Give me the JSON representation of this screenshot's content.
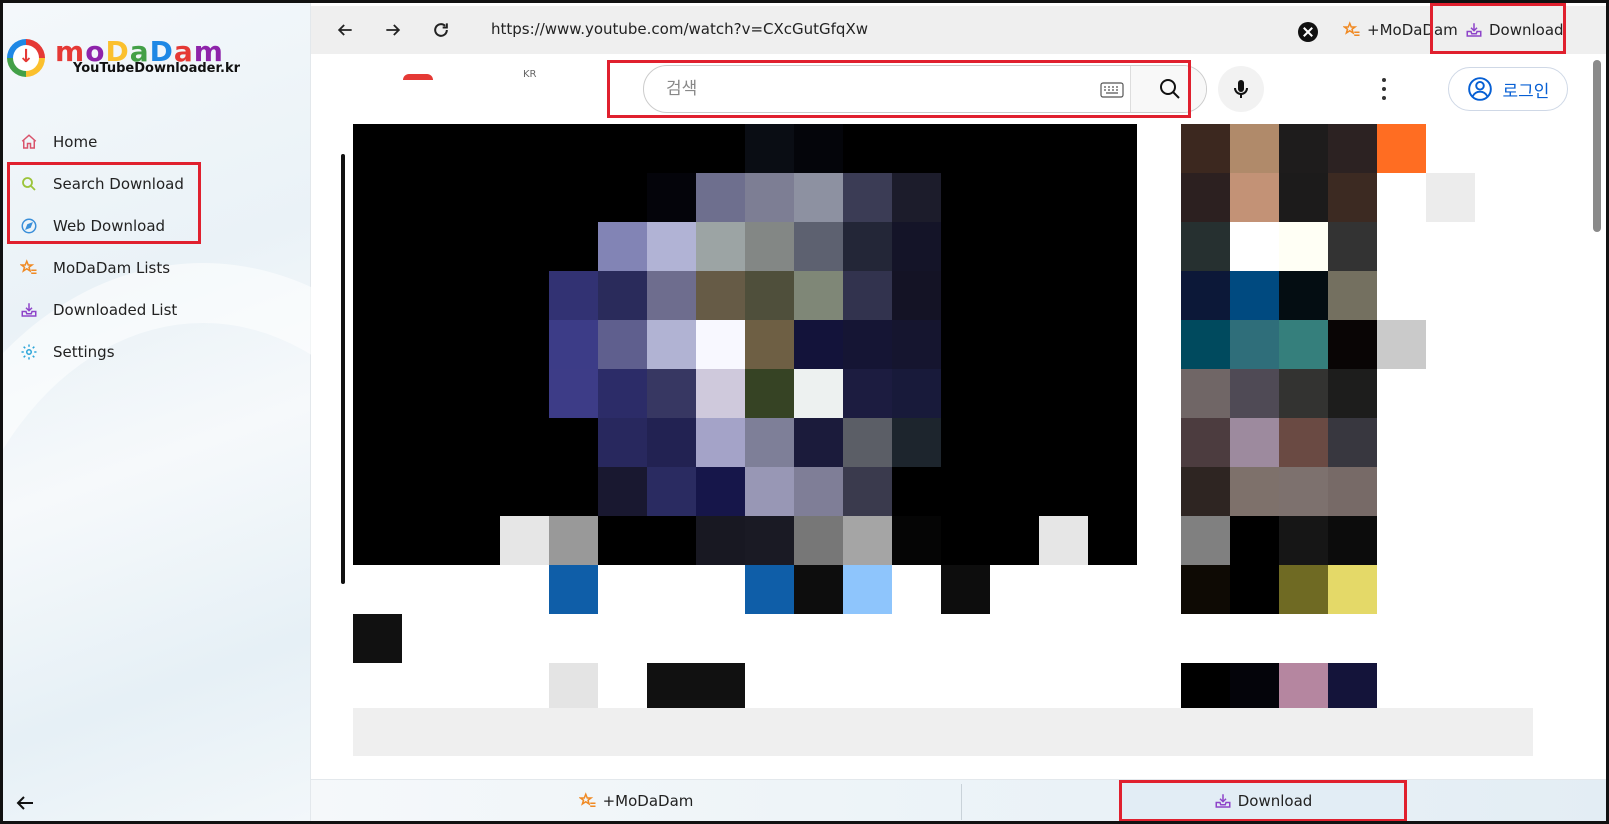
{
  "brand": {
    "logo_letters": [
      "m",
      "o",
      "D",
      "a",
      "D",
      "a",
      "m"
    ],
    "subtitle": "YouTubeDownloader.kr",
    "colors": {
      "red": "#e53935",
      "purple": "#8e24aa",
      "yellow": "#fbc02d",
      "green": "#43a047",
      "blue": "#1e88e5"
    }
  },
  "sidebar": {
    "items": [
      {
        "label": "Home",
        "icon": "home-icon",
        "color": "#d9536b"
      },
      {
        "label": "Search Download",
        "icon": "search-icon",
        "color": "#9bc43a"
      },
      {
        "label": "Web Download",
        "icon": "compass-icon",
        "color": "#3a8fd9"
      },
      {
        "label": "MoDaDam Lists",
        "icon": "star-list-icon",
        "color": "#f08a24"
      },
      {
        "label": "Downloaded List",
        "icon": "tray-download-icon",
        "color": "#8e44c9"
      },
      {
        "label": "Settings",
        "icon": "gear-icon",
        "color": "#2ba5d9"
      }
    ],
    "back_icon": "arrow-left-icon"
  },
  "browser": {
    "url": "https://www.youtube.com/watch?v=CXcGutGfqXw",
    "nav_icons": [
      "back-arrow-icon",
      "forward-arrow-icon",
      "reload-icon"
    ],
    "top_modadam_label": "+MoDaDam",
    "top_download_label": "Download"
  },
  "youtube": {
    "region": "KR",
    "search_placeholder": "검색",
    "login_label": "로그인"
  },
  "bottom_bar": {
    "modadam_label": "+MoDaDam",
    "download_label": "Download"
  },
  "accent": {
    "highlight": "#e0202e",
    "link_blue": "#065fd4"
  },
  "pixelated_video": {
    "cols": 16,
    "rows": [
      [
        "#000",
        "#000",
        "#000",
        "#000",
        "#000",
        "#000",
        "#000",
        "#000",
        "#0a0d14",
        "#04050a",
        "#000",
        "#000",
        "#000",
        "#000",
        "#000",
        "#000"
      ],
      [
        "#000",
        "#000",
        "#000",
        "#000",
        "#000",
        "#000",
        "#04040a",
        "#6e6f8e",
        "#7d7e94",
        "#8d91a1",
        "#3b3c55",
        "#1c1c2b",
        "#000",
        "#000",
        "#000",
        "#000"
      ],
      [
        "#000",
        "#000",
        "#000",
        "#000",
        "#000",
        "#8284b5",
        "#b1b3d5",
        "#9ca4a4",
        "#838785",
        "#5d6170",
        "#232637",
        "#141428",
        "#000",
        "#000",
        "#000",
        "#000"
      ],
      [
        "#000",
        "#000",
        "#000",
        "#000",
        "#323273",
        "#2a2b5b",
        "#6e6d8e",
        "#665b46",
        "#4f4f3b",
        "#7f8777",
        "#32334e",
        "#141325",
        "#000",
        "#000",
        "#000",
        "#000"
      ],
      [
        "#000",
        "#000",
        "#000",
        "#000",
        "#3c3c87",
        "#5f5f8e",
        "#b1b3d3",
        "#f8f8ff",
        "#6e5f44",
        "#13133a",
        "#151534",
        "#15152f",
        "#000",
        "#000",
        "#000",
        "#000"
      ],
      [
        "#000",
        "#000",
        "#000",
        "#000",
        "#3d3c87",
        "#2c2c68",
        "#373762",
        "#cfc9dc",
        "#364324",
        "#edf1f0",
        "#1c1c40",
        "#181a3a",
        "#000",
        "#000",
        "#000",
        "#000"
      ],
      [
        "#000",
        "#000",
        "#000",
        "#000",
        "#000",
        "#28285e",
        "#222252",
        "#a4a3c8",
        "#7e7f98",
        "#1b1b3b",
        "#5b5e66",
        "#1d252d",
        "#000",
        "#000",
        "#000",
        "#000"
      ],
      [
        "#000",
        "#000",
        "#000",
        "#000",
        "#000",
        "#191830",
        "#2a2b61",
        "#16164a",
        "#9897b5",
        "#7f7e97",
        "#3a3a4d",
        "#000",
        "#000",
        "#000",
        "#000",
        "#000"
      ],
      [
        "#000",
        "#000",
        "#000",
        "#e6e6e6",
        "#999",
        "#000",
        "#000",
        "#181822",
        "#1a1a24",
        "#777",
        "#a5a5a5",
        "#050505",
        "#000",
        "#000",
        "#e6e6e6",
        "#000"
      ],
      [
        "#fff",
        "#fff",
        "#fff",
        "#fff",
        "#0f5ea8",
        "#fff",
        "#fff",
        "#fff",
        "#0f5ea8",
        "#0d0d0d",
        "#8ec5fc",
        "#fff",
        "#0d0d0d",
        "#fff",
        "#fff",
        "#fff"
      ],
      [
        "#111",
        "#fff",
        "#fff",
        "#fff",
        "#fff",
        "#fff",
        "#fff",
        "#fff",
        "#fff",
        "#fff",
        "#fff",
        "#fff",
        "#fff",
        "#fff",
        "#fff",
        "#fff"
      ],
      [
        "#fff",
        "#fff",
        "#fff",
        "#fff",
        "#e4e4e4",
        "#fff",
        "#111",
        "#111",
        "#fff",
        "#fff",
        "#fff",
        "#fff",
        "#fff",
        "#fff",
        "#fff",
        "#fff"
      ],
      [
        "#fff",
        "#fff",
        "#fff",
        "#fff",
        "#fff",
        "#fff",
        "#fff",
        "#fff",
        "#fff",
        "#fff",
        "#fff",
        "#fff",
        "#fff",
        "#fff",
        "#fff",
        "#fff"
      ]
    ]
  },
  "pixelated_sidebar": {
    "cols": 6,
    "rows": [
      [
        "#3c281f",
        "#b08a6a",
        "#1e1c1c",
        "#2c2222",
        "#ff6d22",
        "#fff"
      ],
      [
        "#2c2020",
        "#c39276",
        "#1c1b1b",
        "#3c2a22",
        "#fff",
        "#ececec"
      ],
      [
        "#263030",
        "#fff",
        "#fffff5",
        "#333",
        "#fff",
        "#fff"
      ],
      [
        "#0c1838",
        "#004a80",
        "#040d12",
        "#747060",
        "#fff",
        "#fff"
      ],
      [
        "#004a5e",
        "#2f6e7a",
        "#357f7c",
        "#090505",
        "#cacaca",
        "#fff"
      ],
      [
        "#706666",
        "#4f4a55",
        "#333331",
        "#1d1d1c",
        "#fff",
        "#fff"
      ],
      [
        "#4c3c3f",
        "#9d8a9e",
        "#6a4a43",
        "#38373f",
        "#fff",
        "#fff"
      ],
      [
        "#2e2522",
        "#7e716b",
        "#7d716e",
        "#776a67",
        "#fff",
        "#fff"
      ],
      [
        "#808080",
        "#000",
        "#161616",
        "#0c0c0c",
        "#fff",
        "#fff"
      ],
      [
        "#0e0a04",
        "#000",
        "#6f6a23",
        "#e4d968",
        "#fff",
        "#fff"
      ],
      [
        "#fff",
        "#fff",
        "#fff",
        "#fff",
        "#fff",
        "#fff"
      ],
      [
        "#000",
        "#04040a",
        "#b586a0",
        "#14143a",
        "#fff",
        "#fff"
      ],
      [
        "#fff",
        "#fff",
        "#fff",
        "#fff",
        "#fff",
        "#fff"
      ]
    ]
  }
}
